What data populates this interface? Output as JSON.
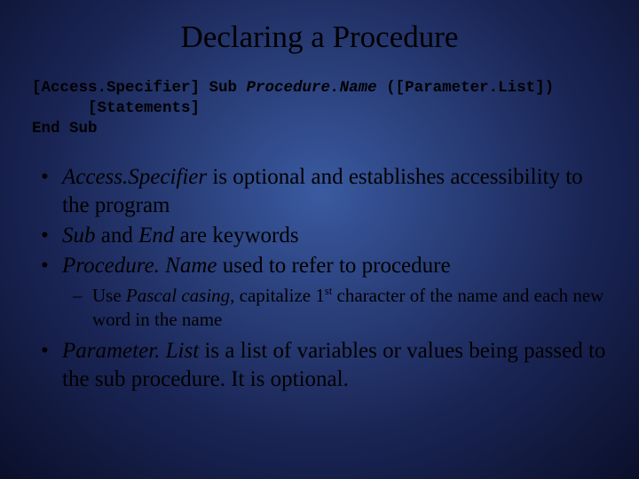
{
  "title": "Declaring a Procedure",
  "code": {
    "l1a": "[Access.Specifier] Sub ",
    "l1b": "Procedure.Name",
    "l1c": " ([Parameter.List])",
    "l2": "      [Statements]",
    "l3": "End Sub"
  },
  "b1": {
    "term": "Access.Specifier",
    "rest": " is optional and establishes accessibility to the program"
  },
  "b2": {
    "t1": "Sub",
    "mid": " and ",
    "t2": "End",
    "rest": " are keywords"
  },
  "b3": {
    "term": "Procedure. Name",
    "rest": " used to refer to procedure"
  },
  "b3s": {
    "pre": "Use ",
    "term": "Pascal casing",
    "mid": ", capitalize 1",
    "sup": "st",
    "rest": " character of the name and each new word in the name"
  },
  "b4": {
    "term": "Parameter. List",
    "rest": " is a list of variables or values being passed to the sub procedure. It is optional."
  }
}
